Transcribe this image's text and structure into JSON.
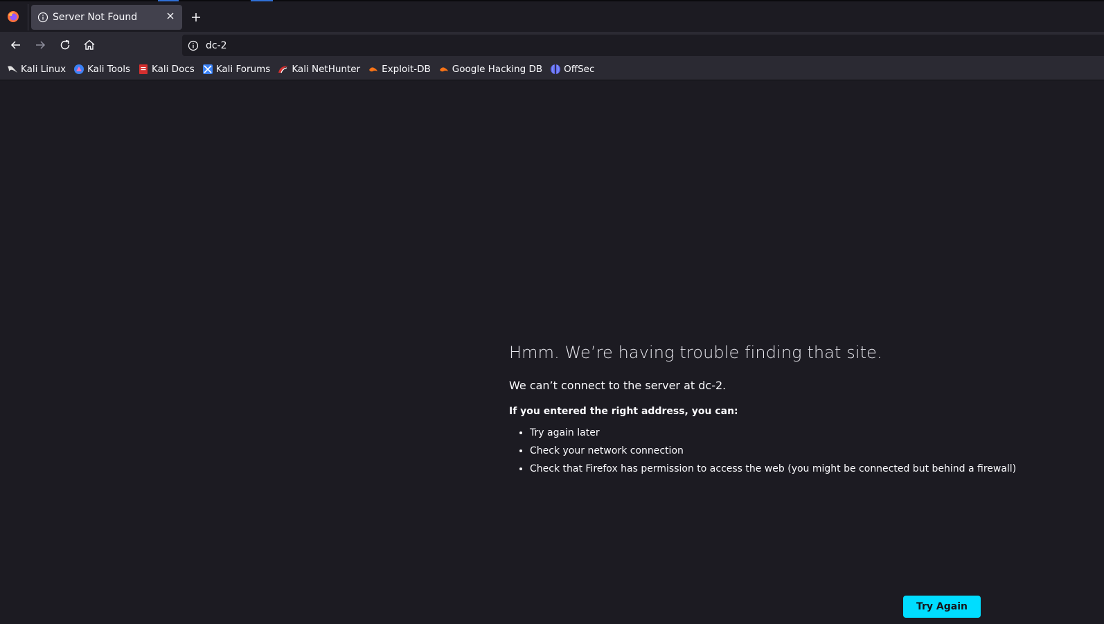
{
  "browser": {
    "tab": {
      "title": "Server Not Found",
      "icon": "info-icon"
    },
    "url": "dc-2"
  },
  "bookmarks": [
    {
      "label": "Kali Linux",
      "icon": "kali-dragon-icon",
      "color": "#e0e0e0"
    },
    {
      "label": "Kali Tools",
      "icon": "kali-tools-icon",
      "color": "#3b82f6"
    },
    {
      "label": "Kali Docs",
      "icon": "kali-docs-icon",
      "color": "#d32f2f"
    },
    {
      "label": "Kali Forums",
      "icon": "kali-forums-icon",
      "color": "#3b82f6"
    },
    {
      "label": "Kali NetHunter",
      "icon": "kali-nethunter-icon",
      "color": "#d32f2f"
    },
    {
      "label": "Exploit-DB",
      "icon": "exploit-db-icon",
      "color": "#f97316"
    },
    {
      "label": "Google Hacking DB",
      "icon": "ghdb-icon",
      "color": "#f97316"
    },
    {
      "label": "OffSec",
      "icon": "offsec-icon",
      "color": "#6366f1"
    }
  ],
  "error": {
    "title": "Hmm. We’re having trouble finding that site.",
    "description": "We can’t connect to the server at dc-2.",
    "subtitle": "If you entered the right address, you can:",
    "suggestions": [
      "Try again later",
      "Check your network connection",
      "Check that Firefox has permission to access the web (you might be connected but behind a firewall)"
    ],
    "button_label": "Try Again"
  },
  "colors": {
    "accent": "#00ddff",
    "page_bg": "#1c1b22",
    "toolbar_bg": "#2b2a33"
  }
}
